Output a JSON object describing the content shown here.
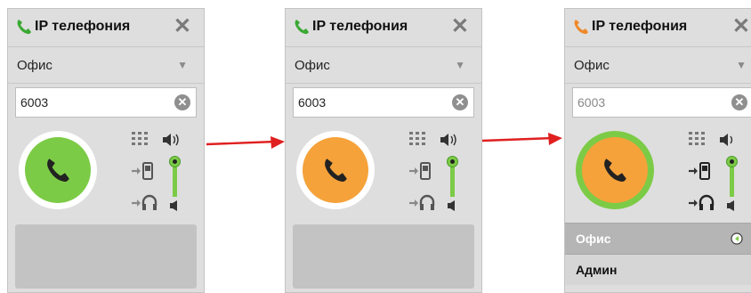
{
  "panels": [
    {
      "title": "IP телефония",
      "close_icon": "close-icon",
      "line_select": "Офис",
      "number": "6003",
      "call_color": "#7ccb46",
      "state": "idle"
    },
    {
      "title": "IP телефония",
      "close_icon": "close-icon",
      "line_select": "Офис",
      "number": "6003",
      "call_color": "#f5a23a",
      "state": "dialing"
    },
    {
      "title": "IP телефония",
      "close_icon": "close-icon",
      "line_select": "Офис",
      "number": "6003",
      "call_color": "#f5a23a",
      "state": "connecting",
      "contacts": [
        "Офис",
        "Админ"
      ]
    }
  ],
  "colors": {
    "arrow": "#e02020",
    "accent_green": "#7ccb46",
    "accent_orange": "#f5a23a"
  },
  "symbols": {
    "close": "✕",
    "dropdown": "▼",
    "clear": "✕"
  }
}
